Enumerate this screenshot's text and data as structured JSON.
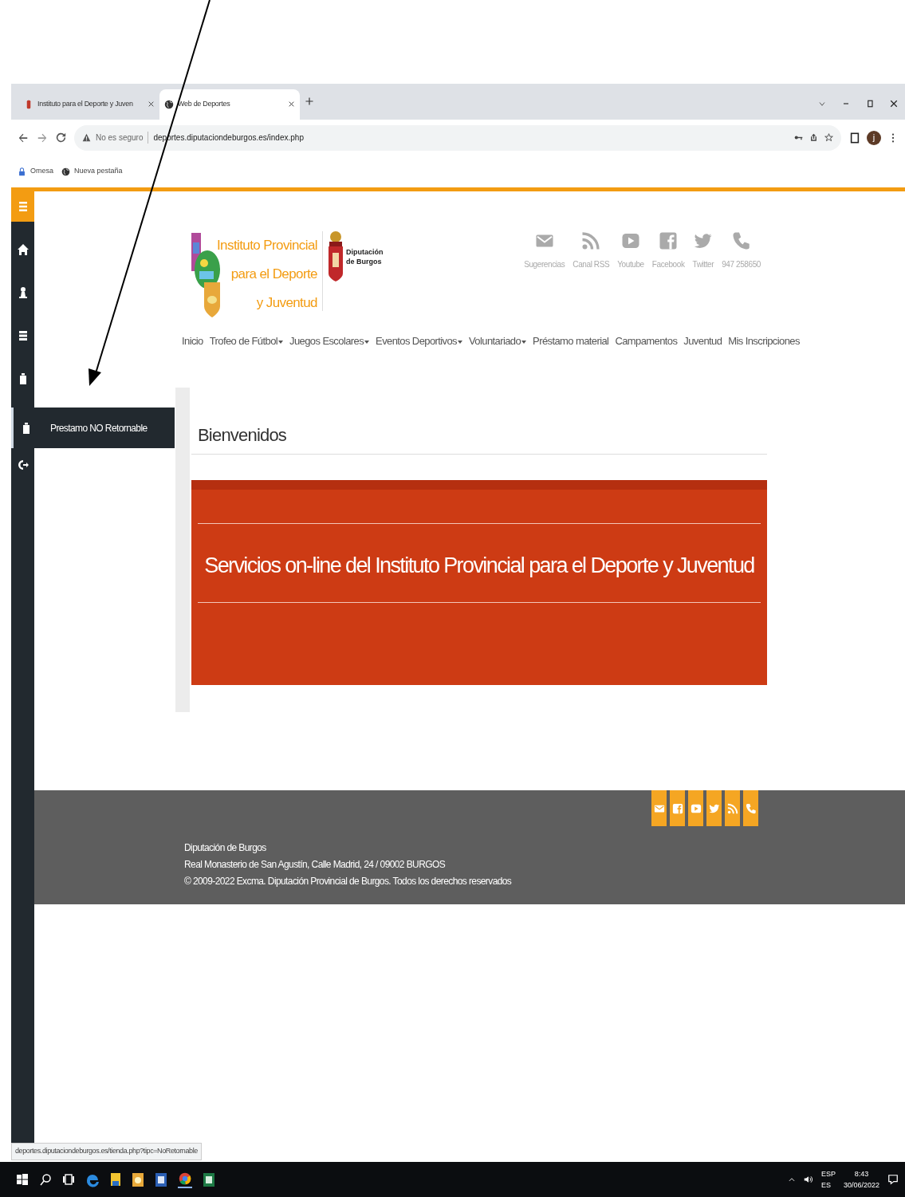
{
  "browser": {
    "tabs": [
      {
        "title": "Instituto para el Deporte y Juven",
        "selected": false
      },
      {
        "title": "Web de Deportes",
        "selected": true
      }
    ],
    "security": "No es seguro",
    "url": "deportes.diputaciondeburgos.es/index.php",
    "profile_initial": "j",
    "bookmarks": [
      "Omesa",
      "Nueva pestaña"
    ]
  },
  "sidebar": {
    "items": [
      {
        "kind": "home",
        "hovered": false
      },
      {
        "kind": "user",
        "hovered": false
      },
      {
        "kind": "list",
        "hovered": false
      },
      {
        "kind": "bag",
        "hovered": false
      },
      {
        "kind": "bag",
        "hovered": true
      },
      {
        "kind": "logout",
        "hovered": false
      }
    ],
    "flyout": "Prestamo NO Retornable"
  },
  "header": {
    "logo_lines": [
      "Instituto Provincial",
      "para el Deporte",
      "y Juventud"
    ],
    "partner_lines": [
      "Diputación",
      "de Burgos"
    ],
    "links": [
      {
        "kind": "mail",
        "label": "Sugerencias"
      },
      {
        "kind": "rss",
        "label": "Canal RSS"
      },
      {
        "kind": "youtube",
        "label": "Youtube"
      },
      {
        "kind": "facebook",
        "label": "Facebook"
      },
      {
        "kind": "twitter",
        "label": "Twitter"
      },
      {
        "kind": "phone",
        "label": "947 258650"
      }
    ]
  },
  "nav": [
    {
      "label": "Inicio",
      "dropdown": false
    },
    {
      "label": "Trofeo de Fútbol",
      "dropdown": true
    },
    {
      "label": "Juegos Escolares",
      "dropdown": true
    },
    {
      "label": "Eventos Deportivos",
      "dropdown": true
    },
    {
      "label": "Voluntariado",
      "dropdown": true
    },
    {
      "label": "Préstamo material",
      "dropdown": false
    },
    {
      "label": "Campamentos",
      "dropdown": false
    },
    {
      "label": "Juventud",
      "dropdown": false
    },
    {
      "label": "Mis Inscripciones",
      "dropdown": false
    }
  ],
  "page_title": "Bienvenidos",
  "banner": "Servicios on-line del Instituto Provincial para el Deporte y Juventud",
  "footer": {
    "buttons": [
      {
        "kind": "mail"
      },
      {
        "kind": "facebook"
      },
      {
        "kind": "youtube"
      },
      {
        "kind": "twitter"
      },
      {
        "kind": "rss"
      },
      {
        "kind": "phone"
      }
    ],
    "lines": [
      "Diputación de Burgos",
      "Real Monasterio de San Agustín, Calle Madrid, 24 / 09002 BURGOS",
      "© 2009-2022 Excma. Diputación Provincial de Burgos. Todos los derechos reservados"
    ]
  },
  "status_url": "deportes.diputaciondeburgos.es/tienda.php?tipc=NoRetornable",
  "taskbar": {
    "language": "ESP",
    "keyboard": "ES",
    "time": "8:43",
    "date": "30/06/2022"
  }
}
